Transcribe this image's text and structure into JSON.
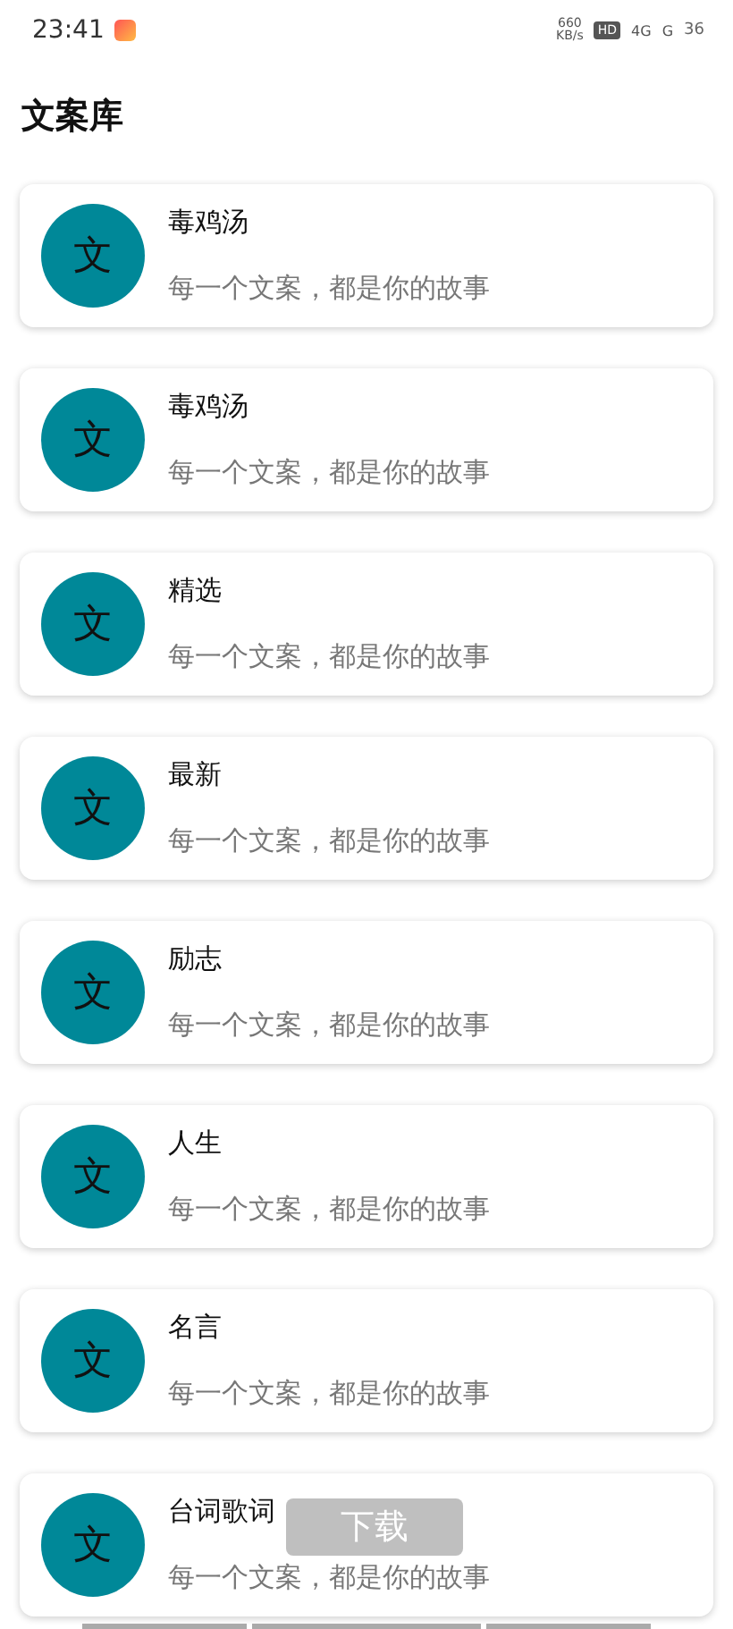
{
  "status_bar": {
    "time": "23:41",
    "speed": "660",
    "speed_unit": "KB/s",
    "hd": "HD",
    "network": "4G",
    "network2": "G",
    "battery": "36"
  },
  "title": "文案库",
  "items": [
    {
      "avatar": "文",
      "name": "毒鸡汤",
      "subtitle": "每一个文案，都是你的故事"
    },
    {
      "avatar": "文",
      "name": "毒鸡汤",
      "subtitle": "每一个文案，都是你的故事"
    },
    {
      "avatar": "文",
      "name": "精选",
      "subtitle": "每一个文案，都是你的故事"
    },
    {
      "avatar": "文",
      "name": "最新",
      "subtitle": "每一个文案，都是你的故事"
    },
    {
      "avatar": "文",
      "name": "励志",
      "subtitle": "每一个文案，都是你的故事"
    },
    {
      "avatar": "文",
      "name": "人生",
      "subtitle": "每一个文案，都是你的故事"
    },
    {
      "avatar": "文",
      "name": "名言",
      "subtitle": "每一个文案，都是你的故事"
    },
    {
      "avatar": "文",
      "name": "台词歌词",
      "subtitle": "每一个文案，都是你的故事"
    }
  ],
  "toast": "下载"
}
